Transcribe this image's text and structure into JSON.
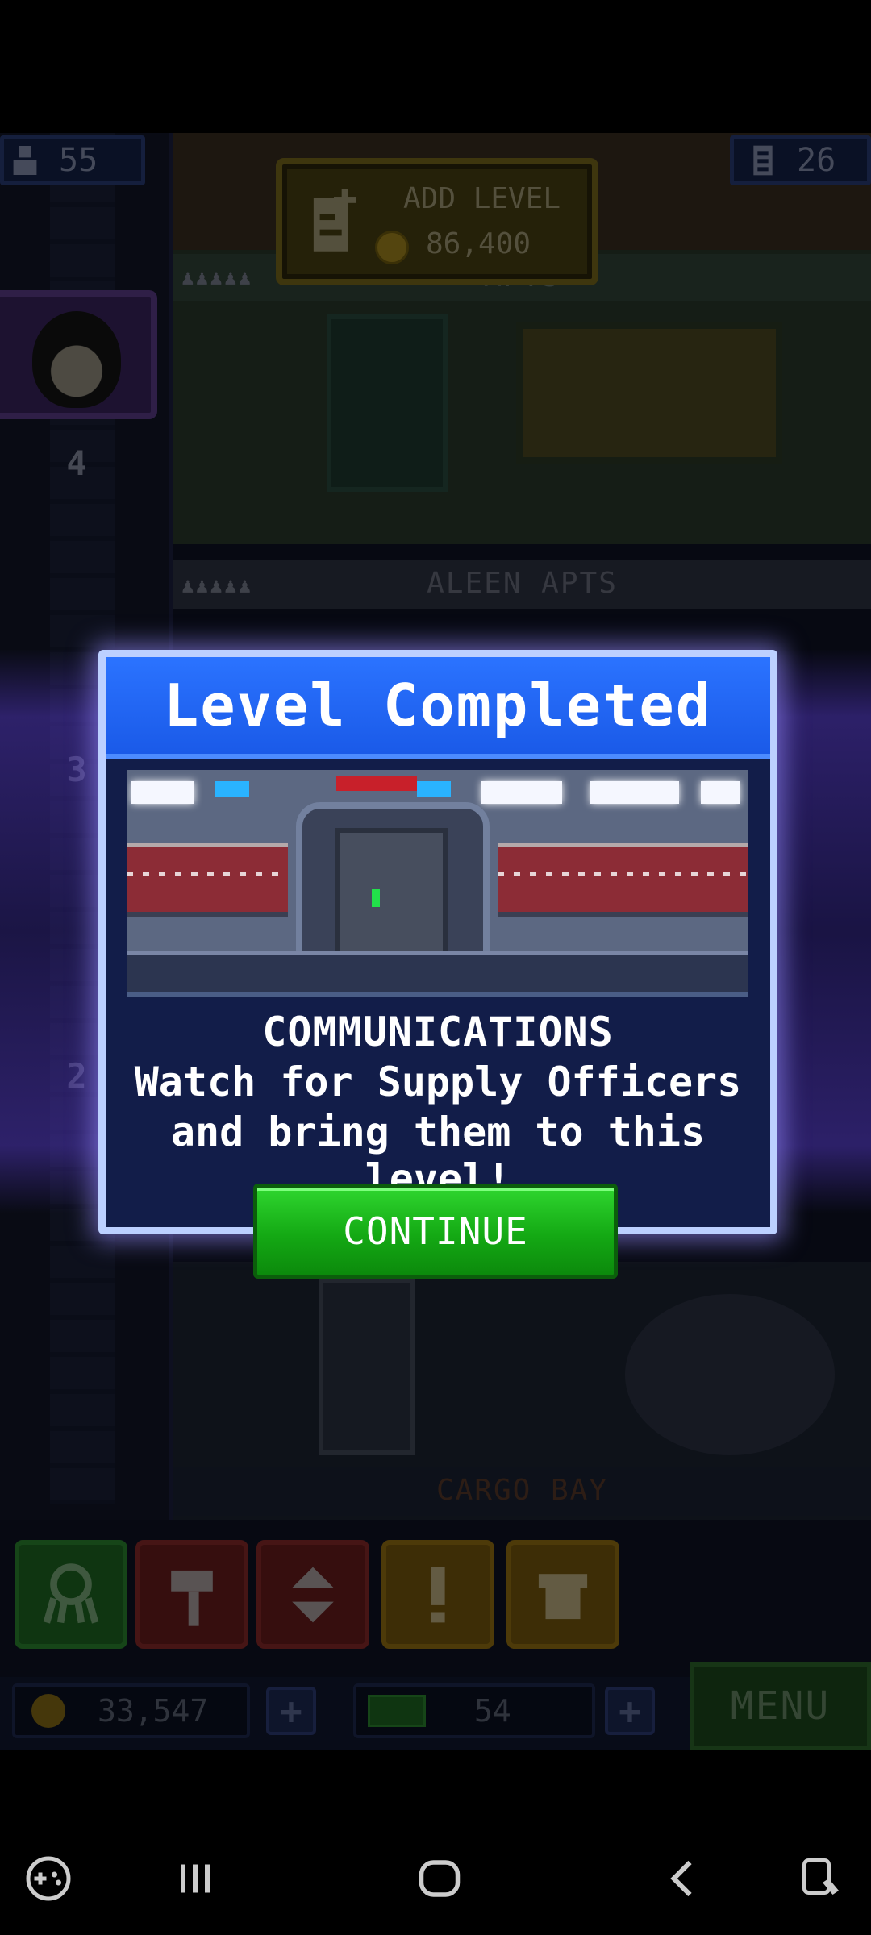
{
  "hud": {
    "population": "55",
    "floors": "26",
    "add_level": {
      "title": "ADD LEVEL",
      "cost": "86,400"
    }
  },
  "scene": {
    "rooms": [
      {
        "label": "APTS"
      },
      {
        "label": "ALEEN APTS"
      },
      {
        "label": "CARGO BAY"
      }
    ],
    "shaft_floor_numbers": [
      "4",
      "3",
      "2"
    ]
  },
  "dialog": {
    "title": "Level Completed",
    "room_name": "COMMUNICATIONS",
    "description_line1": "Watch for Supply Officers",
    "description_line2": "and bring them to this level!",
    "continue_label": "CONTINUE"
  },
  "bottom_bar": {
    "coins": "33,547",
    "bux": "54",
    "menu_label": "MENU"
  },
  "toolbar_icons": [
    "alien-icon",
    "hammer-icon",
    "elevator-arrows-icon",
    "alert-icon",
    "box-icon"
  ],
  "colors": {
    "dialog_header": "#2166f5",
    "continue_button": "#18b418",
    "dialog_border": "#bcd0ff"
  }
}
